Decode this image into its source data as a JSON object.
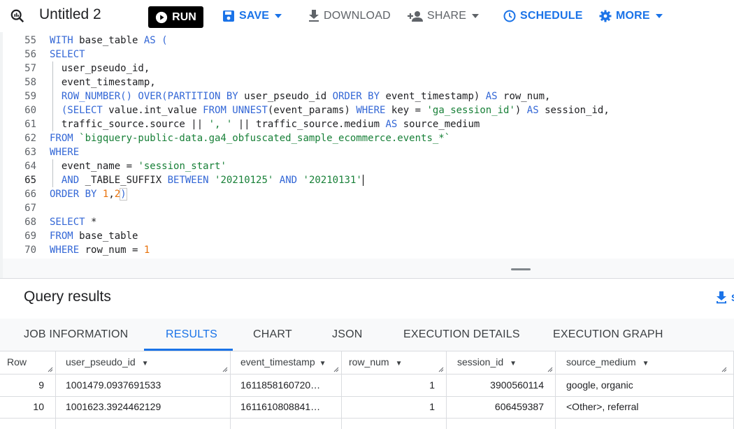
{
  "toolbar": {
    "title": "Untitled 2",
    "run_label": "RUN",
    "save_label": "SAVE",
    "download_label": "DOWNLOAD",
    "share_label": "SHARE",
    "schedule_label": "SCHEDULE",
    "more_label": "MORE"
  },
  "editor": {
    "lines": [
      {
        "n": "55"
      },
      {
        "n": "56"
      },
      {
        "n": "57"
      },
      {
        "n": "58"
      },
      {
        "n": "59"
      },
      {
        "n": "60"
      },
      {
        "n": "61"
      },
      {
        "n": "62"
      },
      {
        "n": "63"
      },
      {
        "n": "64"
      },
      {
        "n": "65"
      },
      {
        "n": "66"
      },
      {
        "n": "67"
      },
      {
        "n": "68"
      },
      {
        "n": "69"
      },
      {
        "n": "70"
      }
    ],
    "t": {
      "l55a": "WITH",
      "l55b": " base_table ",
      "l55c": "AS",
      "l55d": " (",
      "l56a": "SELECT",
      "l57a": "  user_pseudo_id,",
      "l58a": "  event_timestamp,",
      "l59a": "  ROW_NUMBER() OVER(PARTITION BY",
      "l59b": " user_pseudo_id ",
      "l59c": "ORDER BY",
      "l59d": " event_timestamp) ",
      "l59e": "AS",
      "l59f": " row_num,",
      "l60a": "  (SELECT",
      "l60b": " value.int_value ",
      "l60c": "FROM UNNEST",
      "l60d": "(event_params) ",
      "l60e": "WHERE",
      "l60f": " key = ",
      "l60g": "'ga_session_id'",
      "l60h": ") ",
      "l60i": "AS",
      "l60j": " session_id,",
      "l61a": "  traffic_source.source || ",
      "l61b": "', '",
      "l61c": " || traffic_source.medium ",
      "l61d": "AS",
      "l61e": " source_medium",
      "l62a": "FROM",
      "l62b": " `bigquery-public-data.ga4_obfuscated_sample_ecommerce.events_*`",
      "l63a": "WHERE",
      "l64a": "  event_name = ",
      "l64b": "'session_start'",
      "l65a": "  AND",
      "l65b": " _TABLE_SUFFIX ",
      "l65c": "BETWEEN",
      "l65d": " ",
      "l65e": "'20210125'",
      "l65f": " ",
      "l65g": "AND",
      "l65h": " ",
      "l65i": "'20210131'",
      "l66a": "ORDER BY",
      "l66b": " ",
      "l66c": "1",
      "l66d": ",",
      "l66e": "2",
      "l66f": ")",
      "l68a": "SELECT",
      "l68b": " *",
      "l69a": "FROM",
      "l69b": " base_table",
      "l70a": "WHERE",
      "l70b": " row_num = ",
      "l70c": "1"
    }
  },
  "results": {
    "title": "Query results",
    "download_label": "S"
  },
  "tabs": [
    "JOB INFORMATION",
    "RESULTS",
    "CHART",
    "JSON",
    "EXECUTION DETAILS",
    "EXECUTION GRAPH"
  ],
  "active_tab": "RESULTS",
  "table": {
    "columns": [
      "Row",
      "user_pseudo_id",
      "event_timestamp",
      "row_num",
      "session_id",
      "source_medium"
    ],
    "rows": [
      [
        "9",
        "1001479.0937691533",
        "1611858160720…",
        "1",
        "3900560114",
        "google, organic"
      ],
      [
        "10",
        "1001623.3924462129",
        "1611610808841…",
        "1",
        "606459387",
        "<Other>, referral"
      ]
    ]
  },
  "colors": {
    "accent": "#1a73e8",
    "keyword": "#3367d6",
    "string": "#188038",
    "number": "#e8710a"
  }
}
